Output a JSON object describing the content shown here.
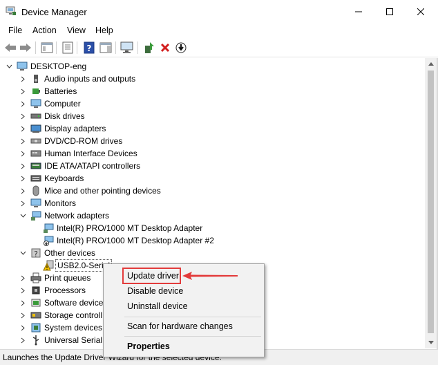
{
  "window": {
    "title": "Device Manager"
  },
  "menubar": [
    "File",
    "Action",
    "View",
    "Help"
  ],
  "tree": {
    "root": "DESKTOP-eng",
    "categories": [
      {
        "label": "Audio inputs and outputs",
        "icon": "speaker-icon"
      },
      {
        "label": "Batteries",
        "icon": "battery-icon"
      },
      {
        "label": "Computer",
        "icon": "monitor-icon"
      },
      {
        "label": "Disk drives",
        "icon": "disk-drive-icon"
      },
      {
        "label": "Display adapters",
        "icon": "display-adapter-icon"
      },
      {
        "label": "DVD/CD-ROM drives",
        "icon": "dvd-drive-icon"
      },
      {
        "label": "Human Interface Devices",
        "icon": "hid-icon"
      },
      {
        "label": "IDE ATA/ATAPI controllers",
        "icon": "ide-controller-icon"
      },
      {
        "label": "Keyboards",
        "icon": "keyboard-icon"
      },
      {
        "label": "Mice and other pointing devices",
        "icon": "mouse-icon"
      },
      {
        "label": "Monitors",
        "icon": "monitor-icon"
      },
      {
        "label": "Network adapters",
        "icon": "network-icon"
      },
      {
        "label": "Intel(R) PRO/1000 MT Desktop Adapter",
        "icon": "network-icon"
      },
      {
        "label": "Intel(R) PRO/1000 MT Desktop Adapter #2",
        "icon": "network-disabled-icon"
      },
      {
        "label": "Other devices",
        "icon": "unknown-device-icon"
      },
      {
        "label": "USB2.0-Serial",
        "icon": "warning-device-icon"
      },
      {
        "label": "Print queues",
        "icon": "printer-icon"
      },
      {
        "label": "Processors",
        "icon": "cpu-icon"
      },
      {
        "label": "Software device",
        "icon": "software-device-icon"
      },
      {
        "label": "Storage controll",
        "icon": "storage-controller-icon"
      },
      {
        "label": "System devices",
        "icon": "system-device-icon"
      },
      {
        "label": "Universal Serial",
        "icon": "usb-icon"
      }
    ]
  },
  "context_menu": {
    "items": [
      "Update driver",
      "Disable device",
      "Uninstall device",
      "Scan for hardware changes",
      "Properties"
    ]
  },
  "status": "Launches the Update Driver Wizard for the selected device.",
  "colors": {
    "highlight": "#e33b3b",
    "toolbar_red_x": "#d21f1f",
    "toolbar_green": "#3a9a3a"
  }
}
